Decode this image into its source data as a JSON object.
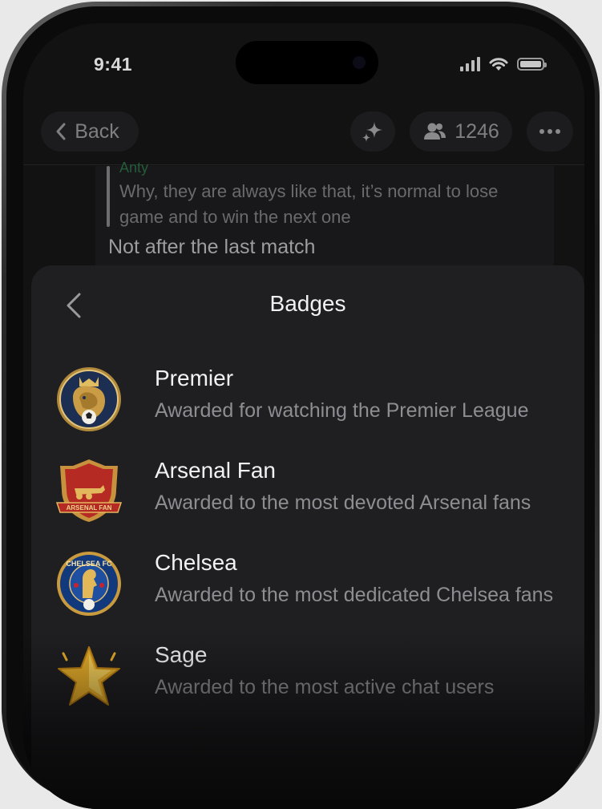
{
  "status_bar": {
    "time": "9:41"
  },
  "chat_header": {
    "back_label": "Back",
    "members_count": "1246"
  },
  "message": {
    "reply_author": "Anty",
    "reply_text": "Why, they are always like that, it’s normal to lose game and to win the next one",
    "text": "Not after the last match"
  },
  "sheet": {
    "title": "Badges",
    "badges": [
      {
        "name": "Premier",
        "description": "Awarded for watching the Premier League",
        "icon": "lion-crest-icon"
      },
      {
        "name": "Arsenal Fan",
        "description": "Awarded to the most devoted Arsenal fans",
        "icon": "arsenal-crest-icon",
        "icon_text": "ARSENAL FAN"
      },
      {
        "name": "Chelsea",
        "description": "Awarded to the most dedicated Chelsea fans",
        "icon": "chelsea-crest-icon",
        "icon_text": "CHELSEA FC"
      },
      {
        "name": "Sage",
        "description": "Awarded to the most active chat users",
        "icon": "gold-star-icon"
      }
    ]
  },
  "colors": {
    "background": "#121213",
    "sheet": "#1f1f22",
    "primary_text": "#f2f2f4",
    "secondary_text": "#8d8d92",
    "reply_author": "#245c3a"
  }
}
